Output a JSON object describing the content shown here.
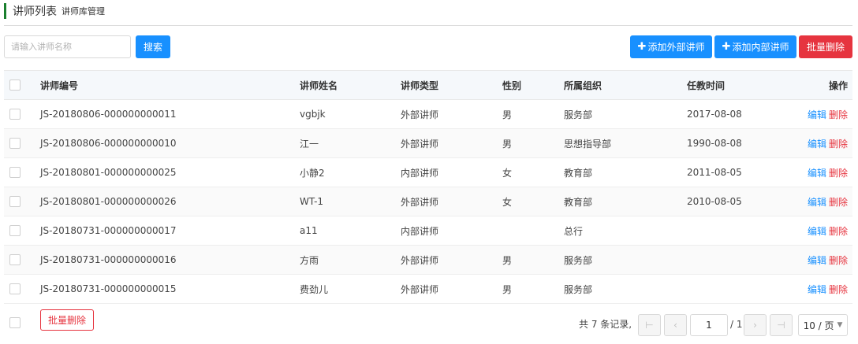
{
  "header": {
    "title": "讲师列表",
    "subtitle": "讲师库管理"
  },
  "toolbar": {
    "search_placeholder": "请输入讲师名称",
    "search_label": "搜索",
    "add_external_label": "添加外部讲师",
    "add_internal_label": "添加内部讲师",
    "batch_delete_label": "批量删除"
  },
  "table": {
    "columns": {
      "id": "讲师编号",
      "name": "讲师姓名",
      "type": "讲师类型",
      "gender": "性别",
      "org": "所属组织",
      "date": "任教时间",
      "op": "操作"
    },
    "rows": [
      {
        "id": "JS-20180806-000000000011",
        "name": "vgbjk",
        "type": "外部讲师",
        "gender": "男",
        "org": "服务部",
        "date": "2017-08-08"
      },
      {
        "id": "JS-20180806-000000000010",
        "name": "江一",
        "type": "外部讲师",
        "gender": "男",
        "org": "思想指导部",
        "date": "1990-08-08"
      },
      {
        "id": "JS-20180801-000000000025",
        "name": "小静2",
        "type": "内部讲师",
        "gender": "女",
        "org": "教育部",
        "date": "2011-08-05"
      },
      {
        "id": "JS-20180801-000000000026",
        "name": "WT-1",
        "type": "外部讲师",
        "gender": "女",
        "org": "教育部",
        "date": "2010-08-05"
      },
      {
        "id": "JS-20180731-000000000017",
        "name": "a11",
        "type": "内部讲师",
        "gender": "",
        "org": "总行",
        "date": ""
      },
      {
        "id": "JS-20180731-000000000016",
        "name": "方雨",
        "type": "外部讲师",
        "gender": "男",
        "org": "服务部",
        "date": ""
      },
      {
        "id": "JS-20180731-000000000015",
        "name": "费劲儿",
        "type": "外部讲师",
        "gender": "男",
        "org": "服务部",
        "date": ""
      }
    ],
    "edit_label": "编辑",
    "delete_label": "删除"
  },
  "footer": {
    "batch_delete_label": "批量删除",
    "total_text": "共 7 条记录,",
    "current_page": "1",
    "of_text": "/ 1",
    "page_size_label": "10 / 页"
  },
  "colors": {
    "primary": "#1890ff",
    "danger": "#e6343f",
    "title_accent": "#1a7f2e"
  }
}
